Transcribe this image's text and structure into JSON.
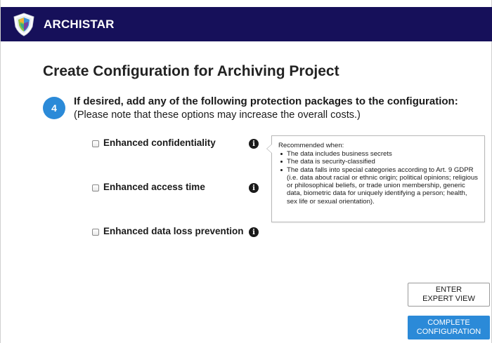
{
  "app": {
    "brand": "ARCHISTAR"
  },
  "page": {
    "title": "Create Configuration for Archiving Project"
  },
  "step": {
    "number": "4",
    "heading": "If desired, add any of the following protection packages to the configuration:",
    "note": "(Please note that these options may increase the overall costs.)"
  },
  "options": [
    {
      "label": "Enhanced confidentiality",
      "checked": false,
      "info_icon": "info-circle-icon"
    },
    {
      "label": "Enhanced access time",
      "checked": false,
      "info_icon": "info-circle-icon"
    },
    {
      "label": "Enhanced data loss prevention",
      "checked": false,
      "info_icon": "info-circle-icon"
    }
  ],
  "tooltip": {
    "title": "Recommended when:",
    "items": [
      "The data includes business secrets",
      "The data is security-classified",
      "The data falls into special categories according to Art. 9 GDPR (i.e. data about racial or ethnic origin; political opinions; religious or philosophical beliefs, or trade union membership, generic data, biometric data for uniquely identifying a person; health, sex life or sexual orientation)."
    ]
  },
  "buttons": {
    "expert_view": "ENTER\nEXPERT VIEW",
    "complete": "COMPLETE\nCONFIGURATION"
  },
  "colors": {
    "header_bg": "#16105a",
    "accent": "#2b8ad8"
  }
}
